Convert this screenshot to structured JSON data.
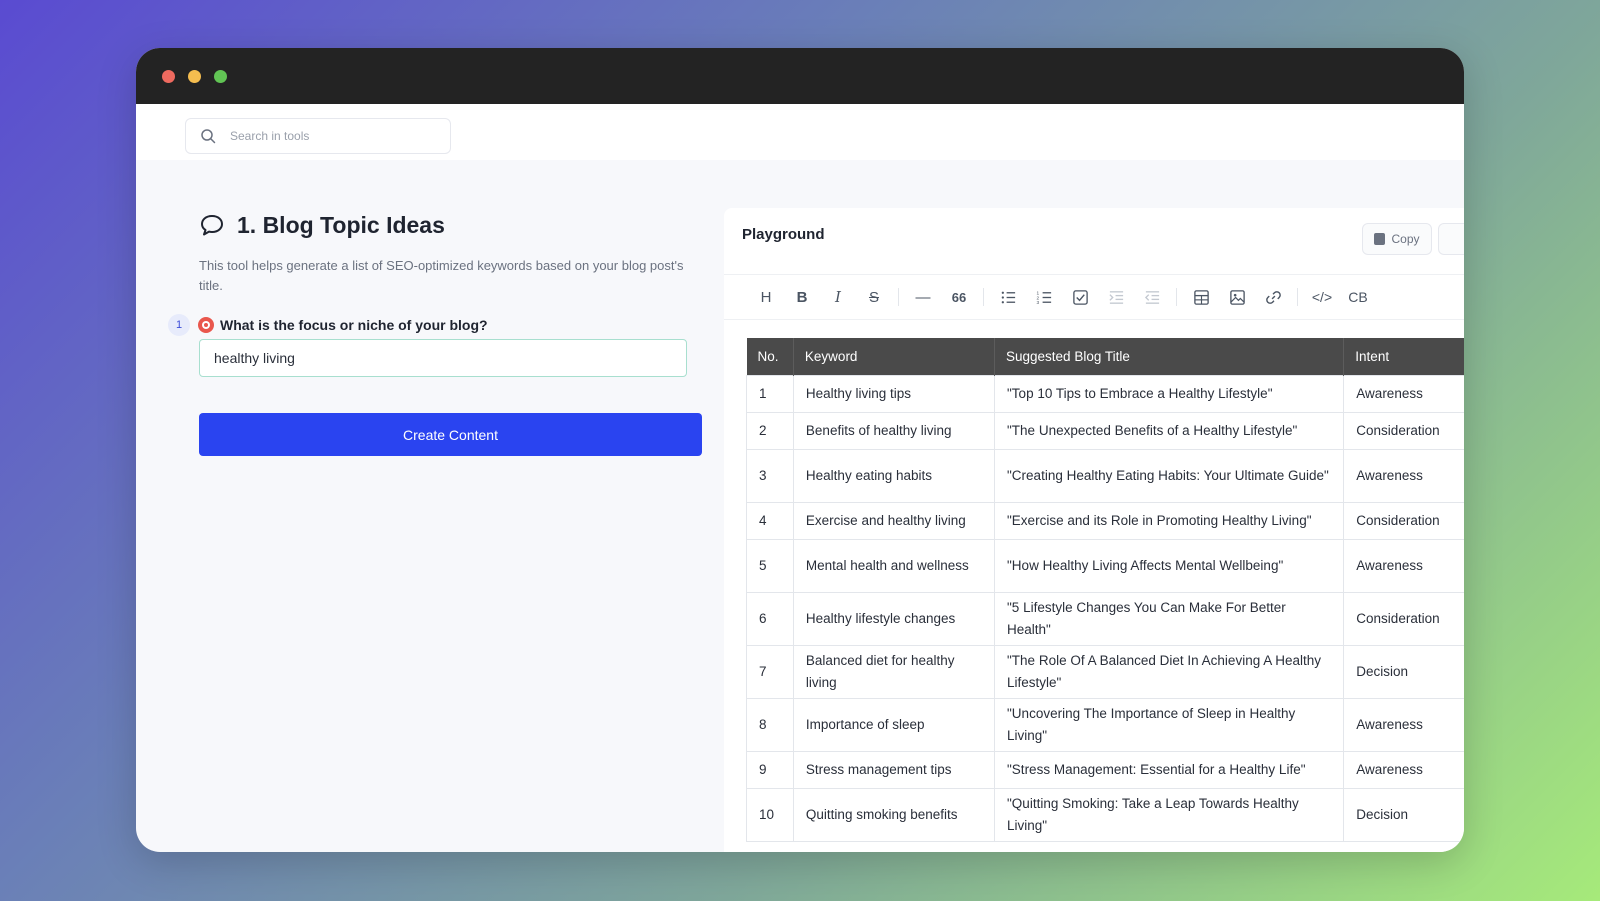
{
  "search": {
    "placeholder": "Search in tools"
  },
  "tool": {
    "title": "1. Blog Topic Ideas",
    "description": "This tool helps generate a list of SEO-optimized keywords based on your blog post's title."
  },
  "question": {
    "number": "1",
    "label": "What is the focus or niche of your blog?",
    "value": "healthy living"
  },
  "create_button": "Create Content",
  "playground": {
    "title": "Playground",
    "copy_label": "Copy",
    "toolbar": [
      "H",
      "B",
      "I",
      "S",
      "—",
      "66",
      "bullet-list",
      "ordered-list",
      "checkbox",
      "indent",
      "outdent",
      "table",
      "image",
      "link",
      "</>",
      "CB"
    ]
  },
  "table": {
    "headers": [
      "No.",
      "Keyword",
      "Suggested Blog Title",
      "Intent"
    ],
    "rows": [
      [
        "1",
        "Healthy living tips",
        "\"Top 10 Tips to Embrace a Healthy Lifestyle\"",
        "Awareness"
      ],
      [
        "2",
        "Benefits of healthy living",
        "\"The Unexpected Benefits of a Healthy Lifestyle\"",
        "Consideration"
      ],
      [
        "3",
        "Healthy eating habits",
        "\"Creating Healthy Eating Habits: Your Ultimate Guide\"",
        "Awareness"
      ],
      [
        "4",
        "Exercise and healthy living",
        "\"Exercise and its Role in Promoting Healthy Living\"",
        "Consideration"
      ],
      [
        "5",
        "Mental health and wellness",
        "\"How Healthy Living Affects Mental Wellbeing\"",
        "Awareness"
      ],
      [
        "6",
        "Healthy lifestyle changes",
        "\"5 Lifestyle Changes You Can Make For Better Health\"",
        "Consideration"
      ],
      [
        "7",
        "Balanced diet for healthy living",
        "\"The Role Of A Balanced Diet In Achieving A Healthy Lifestyle\"",
        "Decision"
      ],
      [
        "8",
        "Importance of sleep",
        "\"Uncovering The Importance of Sleep in Healthy Living\"",
        "Awareness"
      ],
      [
        "9",
        "Stress management tips",
        "\"Stress Management: Essential for a Healthy Life\"",
        "Awareness"
      ],
      [
        "10",
        "Quitting smoking benefits",
        "\"Quitting Smoking: Take a Leap Towards Healthy Living\"",
        "Decision"
      ]
    ]
  },
  "colors": {
    "accent": "#2a44f0",
    "titlebar": "#232323",
    "table_header": "#4a4a4a"
  }
}
